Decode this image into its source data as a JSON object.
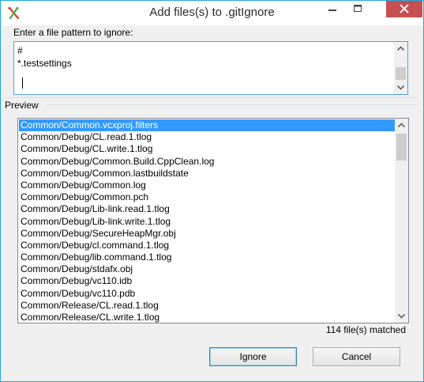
{
  "window": {
    "title": "Add files(s) to .gitIgnore"
  },
  "pattern": {
    "label": "Enter a file pattern to ignore:",
    "lines": [
      "#",
      "*.testsettings"
    ]
  },
  "preview": {
    "label": "Preview",
    "items": [
      "Common/Common.vcxproj.filters",
      "Common/Debug/CL.read.1.tlog",
      "Common/Debug/CL.write.1.tlog",
      "Common/Debug/Common.Build.CppClean.log",
      "Common/Debug/Common.lastbuildstate",
      "Common/Debug/Common.log",
      "Common/Debug/Common.pch",
      "Common/Debug/Lib-link.read.1.tlog",
      "Common/Debug/Lib-link.write.1.tlog",
      "Common/Debug/SecureHeapMgr.obj",
      "Common/Debug/cl.command.1.tlog",
      "Common/Debug/lib.command.1.tlog",
      "Common/Debug/stdafx.obj",
      "Common/Debug/vc110.idb",
      "Common/Debug/vc110.pdb",
      "Common/Release/CL.read.1.tlog",
      "Common/Release/CL.write.1.tlog"
    ],
    "selected_index": 0,
    "matched_text": "114 file(s) matched"
  },
  "buttons": {
    "ignore": "Ignore",
    "cancel": "Cancel"
  },
  "colors": {
    "accent": "#22a9dd",
    "close": "#c74f50",
    "selection": "#3399ff"
  }
}
